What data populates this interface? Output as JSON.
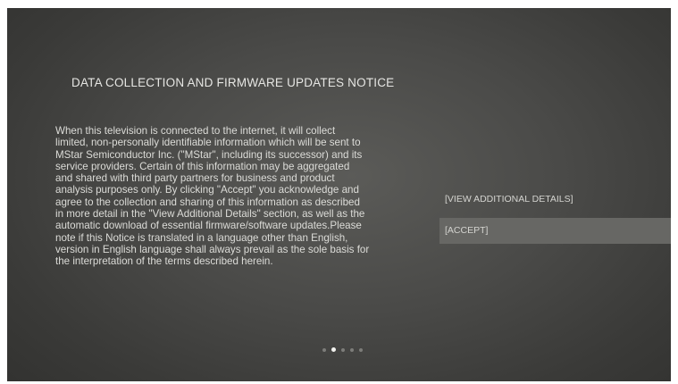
{
  "notice": {
    "title": "DATA COLLECTION AND FIRMWARE UPDATES NOTICE",
    "body_lines": [
      "When this television is connected to the internet, it will collect",
      "limited, non-personally identifiable information which will be sent to",
      "MStar Semiconductor Inc. (\"MStar\", including its successor) and its",
      "service providers. Certain of this information may be aggregated",
      "and shared with third party partners for business and product",
      "analysis purposes only. By clicking \"Accept\" you acknowledge and",
      "agree to the collection and sharing of this information as described",
      "in more detail in the \"View Additional Details\" section, as well as the",
      "automatic download of essential firmware/software updates.Please",
      "note if this Notice is translated in a language other than English,",
      "version in English language shall always prevail as the sole basis for",
      "the interpretation of the terms described herein."
    ]
  },
  "options": {
    "view_details_label": "[VIEW ADDITIONAL DETAILS]",
    "accept_label": "[ACCEPT]"
  },
  "pager": {
    "total_pages": 5,
    "current_page": 2
  },
  "colors": {
    "background_center": "#5b5b58",
    "background_edge": "#333331",
    "selected_option": "#676764",
    "text": "#dcdcd8"
  }
}
